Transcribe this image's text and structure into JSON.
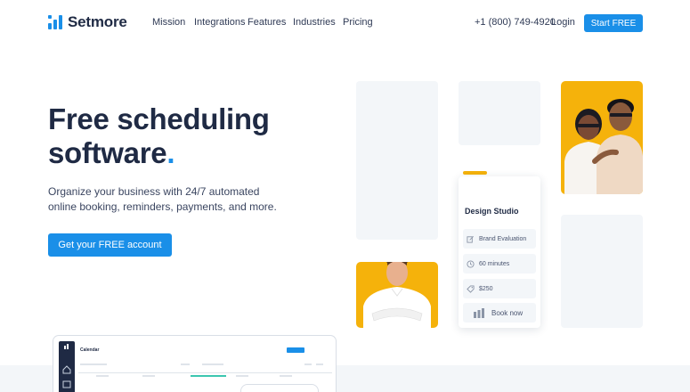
{
  "brand": {
    "name": "Setmore"
  },
  "nav": {
    "links": [
      "Mission",
      "Integrations",
      "Features",
      "Industries",
      "Pricing"
    ],
    "phone": "+1 (800) 749-4920",
    "login": "Login",
    "cta": "Start FREE"
  },
  "hero": {
    "title_line1": "Free scheduling",
    "title_line2": "software",
    "title_dot": ".",
    "subtitle": "Organize your business with 24/7 automated online booking, reminders, payments, and more.",
    "cta": "Get your FREE account"
  },
  "booking_card": {
    "title": "Design Studio",
    "rows": [
      {
        "icon": "edit-icon",
        "text": "Brand Evaluation"
      },
      {
        "icon": "clock-icon",
        "text": "60 minutes"
      },
      {
        "icon": "tag-icon",
        "text": "$250"
      }
    ],
    "book_label": "Book now"
  },
  "preview": {
    "title": "Calendar"
  },
  "colors": {
    "accent": "#1a8fe8",
    "brand_dark": "#1f2a44",
    "photo_bg": "#f5b20b",
    "placeholder": "#f3f6f9"
  }
}
